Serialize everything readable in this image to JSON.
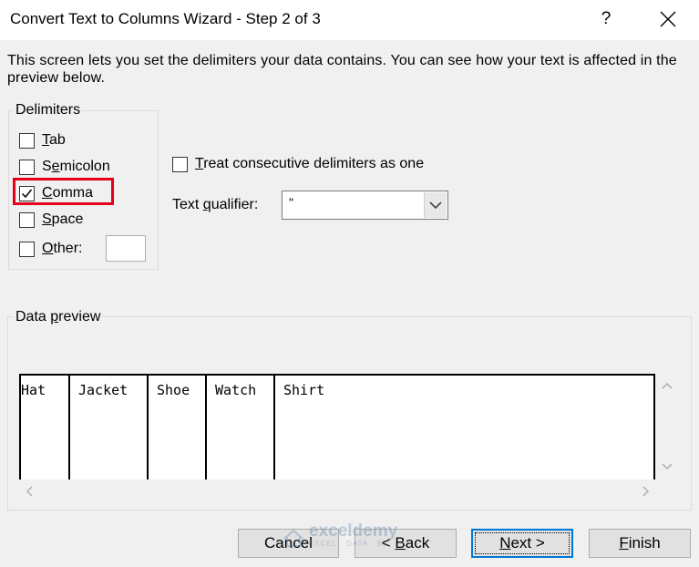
{
  "dialog": {
    "title": "Convert Text to Columns Wizard - Step 2 of 3",
    "help": "?",
    "description": "This screen lets you set the delimiters your data contains.  You can see how your text is affected in the preview below."
  },
  "delimiters": {
    "legend": "Delimiters",
    "items": [
      {
        "pre": "",
        "key": "T",
        "post": "ab",
        "checked": false
      },
      {
        "pre": "S",
        "key": "e",
        "post": "micolon",
        "checked": false
      },
      {
        "pre": "",
        "key": "C",
        "post": "omma",
        "checked": true
      },
      {
        "pre": "",
        "key": "S",
        "post": "pace",
        "checked": false
      },
      {
        "pre": "",
        "key": "O",
        "post": "ther:",
        "checked": false
      }
    ],
    "other_value": ""
  },
  "options": {
    "consecutive": {
      "key": "T",
      "post": "reat consecutive delimiters as one",
      "checked": false
    },
    "qualifier": {
      "pre": "Text ",
      "key": "q",
      "post": "ualifier:",
      "value": "\""
    }
  },
  "preview": {
    "legend_pre": "Data ",
    "legend_key": "p",
    "legend_post": "review",
    "columns": [
      "Hat",
      "Jacket",
      "Shoe",
      "Watch",
      "Shirt"
    ]
  },
  "buttons": {
    "cancel": "Cancel",
    "back": {
      "pre": "< ",
      "key": "B",
      "post": "ack"
    },
    "next": {
      "key": "N",
      "post": "ext >"
    },
    "finish": {
      "key": "F",
      "post": "inish"
    }
  },
  "watermark": {
    "name": "exceldemy",
    "tagline": "EXCEL · DATA · BI"
  }
}
